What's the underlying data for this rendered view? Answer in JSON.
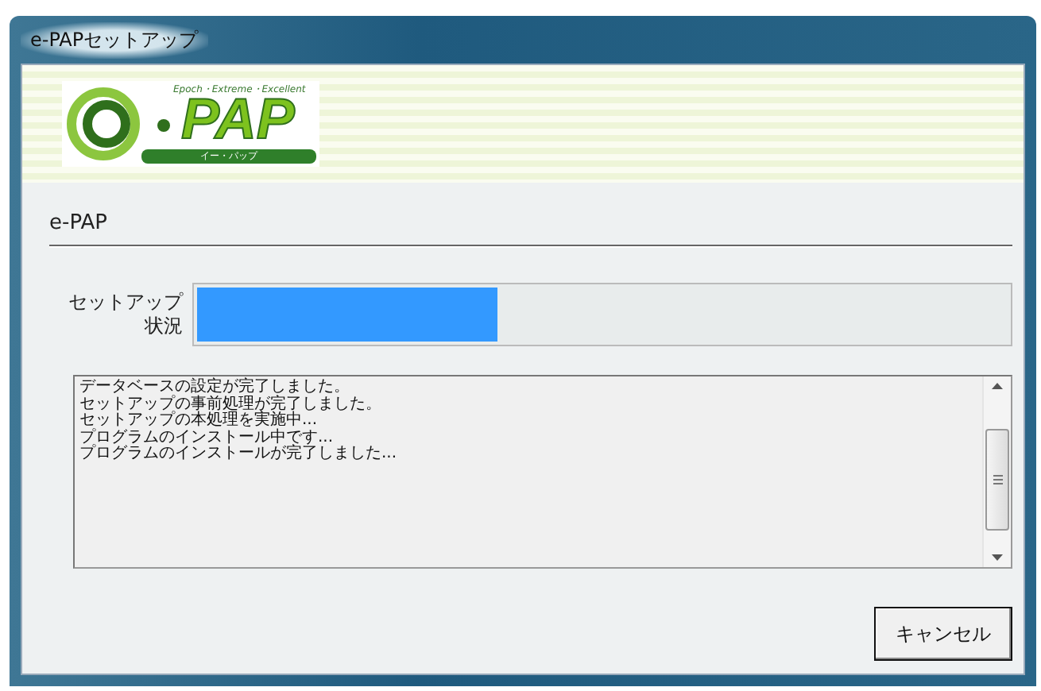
{
  "window": {
    "title": "e-PAPセットアップ"
  },
  "banner": {
    "tagline": "Epoch・Extreme・Excellent",
    "logo_text": "PAP",
    "logo_subtitle": "イー・パップ"
  },
  "section_title": "e-PAP",
  "progress": {
    "label_lines": [
      "セットアップ",
      "状況"
    ],
    "level": 0.37
  },
  "log": [
    "データベースの設定が完了しました。",
    "セットアップの事前処理が完了しました。",
    "セットアップの本処理を実施中...",
    "プログラムのインストール中です...",
    "プログラムのインストールが完了しました..."
  ],
  "buttons": [
    {
      "label": "キャンセル"
    }
  ]
}
